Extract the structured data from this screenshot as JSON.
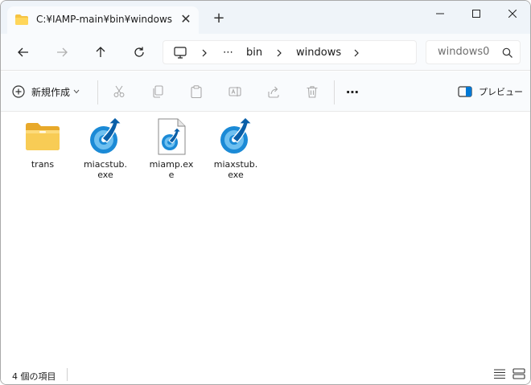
{
  "window": {
    "tab_title": "C:¥IAMP-main¥bin¥windows",
    "tab_close": "✕",
    "new_tab": "+"
  },
  "navbar": {
    "breadcrumb": [
      "⋯",
      "bin",
      "windows"
    ],
    "search_placeholder": "windows0"
  },
  "commandbar": {
    "new_label": "新規作成",
    "more": "⋯",
    "preview_label": "プレビュー"
  },
  "files": [
    {
      "name": "trans",
      "icon": "folder-icon"
    },
    {
      "name": "miacstub.exe",
      "icon": "exe-disc-arrow-icon"
    },
    {
      "name": "miamp.exe",
      "icon": "exe-file-icon"
    },
    {
      "name": "miaxstub.exe",
      "icon": "exe-disc-arrow-icon"
    }
  ],
  "status": {
    "item_count": "4 個の項目"
  },
  "colors": {
    "accent": "#0078d4",
    "folder": "#f5c342",
    "titlebar": "#eff4f9"
  }
}
